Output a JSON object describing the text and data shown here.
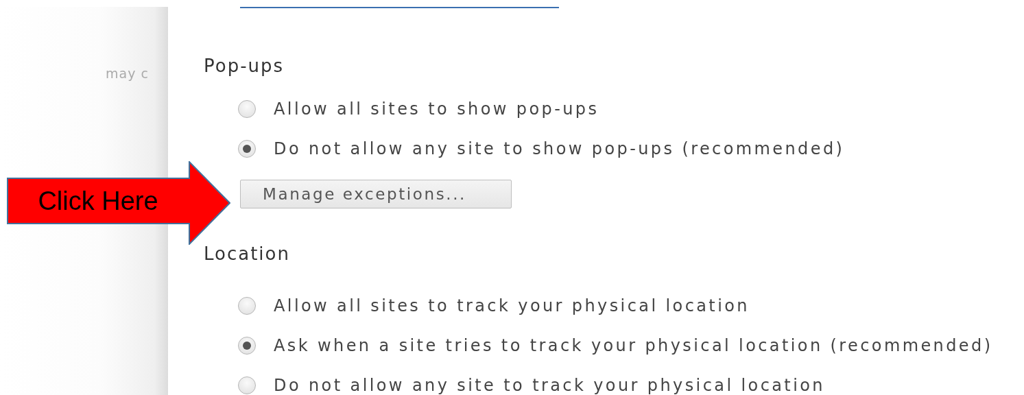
{
  "sidebar": {
    "text": "may c"
  },
  "sections": [
    {
      "heading": "Pop-ups",
      "options": [
        {
          "label": "Allow all sites to show pop-ups",
          "selected": false
        },
        {
          "label": "Do not allow any site to show pop-ups (recommended)",
          "selected": true
        }
      ],
      "button": "Manage exceptions..."
    },
    {
      "heading": "Location",
      "options": [
        {
          "label": "Allow all sites to track your physical location",
          "selected": false
        },
        {
          "label": "Ask when a site tries to track your physical location (recommended)",
          "selected": true
        },
        {
          "label": "Do not allow any site to track your physical location",
          "selected": false
        }
      ]
    }
  ],
  "callout": {
    "text": "Click Here"
  }
}
